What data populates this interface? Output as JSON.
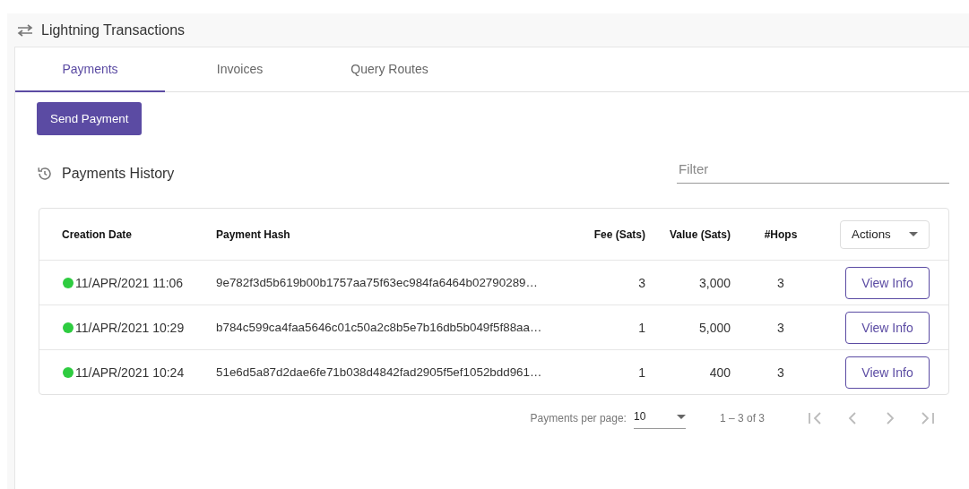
{
  "header": {
    "title": "Lightning Transactions"
  },
  "tabs": [
    {
      "label": "Payments",
      "selected": true
    },
    {
      "label": "Invoices",
      "selected": false
    },
    {
      "label": "Query Routes",
      "selected": false
    }
  ],
  "send_button": "Send Payment",
  "history": {
    "title": "Payments History",
    "filter": {
      "placeholder": "Filter"
    }
  },
  "table": {
    "columns": [
      "Creation Date",
      "Payment Hash",
      "Fee (Sats)",
      "Value (Sats)",
      "#Hops"
    ],
    "actions": "Actions",
    "rows": [
      {
        "color": "#2ecc40",
        "date": "11/APR/2021 11:06",
        "hash": "9e782f3d5b619b00b1757aa75f63ec984fa6464b02790289…",
        "fee": "3",
        "value": "3,000",
        "hops": "3",
        "action": "View Info"
      },
      {
        "color": "#2ecc40",
        "date": "11/APR/2021 10:29",
        "hash": "b784c599ca4faa5646c01c50a2c8b5e7b16db5b049f5f88aa…",
        "fee": "1",
        "value": "5,000",
        "hops": "3",
        "action": "View Info"
      },
      {
        "color": "#2ecc40",
        "date": "11/APR/2021 10:24",
        "hash": "51e6d5a87d2dae6fe71b038d4842fad2905f5ef1052bdd961…",
        "fee": "1",
        "value": "400",
        "hops": "3",
        "action": "View Info"
      }
    ]
  },
  "paginator": {
    "label": "Payments per page:",
    "page_size": "10",
    "range": "1 – 3 of 3",
    "nav": [
      {
        "kind": "first",
        "disabled": true
      },
      {
        "kind": "prev",
        "disabled": true
      },
      {
        "kind": "next",
        "disabled": true
      },
      {
        "kind": "last",
        "disabled": true
      }
    ]
  }
}
